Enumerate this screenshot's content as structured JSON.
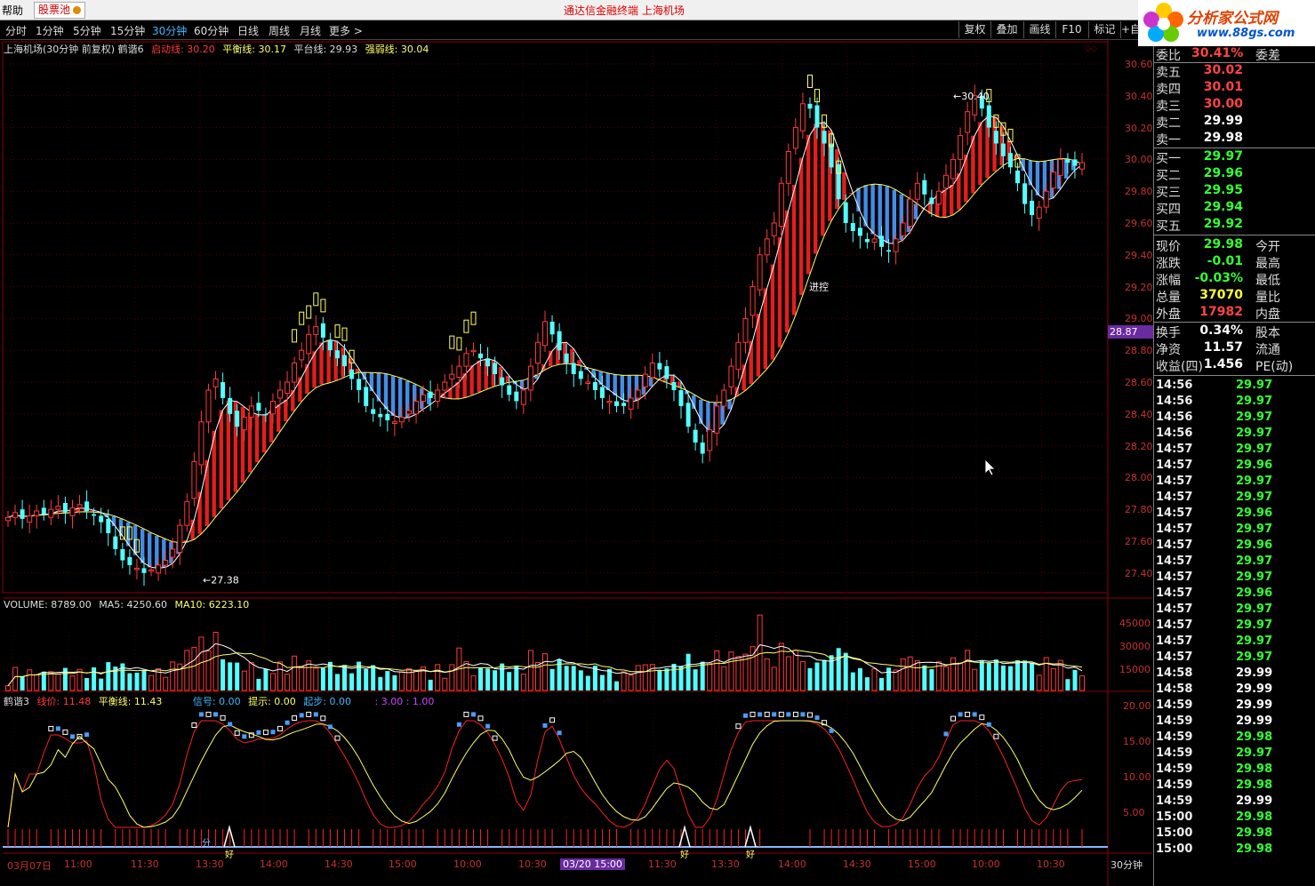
{
  "menu": {
    "help": "帮助",
    "stock_pool": "股票池"
  },
  "app": {
    "title": "通达信金融终端   上海机场"
  },
  "periods": [
    "分时",
    "1分钟",
    "5分钟",
    "15分钟",
    "30分钟",
    "60分钟",
    "日线",
    "周线",
    "月线",
    "更多 >"
  ],
  "active_period": "30分钟",
  "tools": [
    "复权",
    "叠加",
    "画线",
    "F10",
    "标记",
    "+自"
  ],
  "logo": {
    "text": "分析家公式网",
    "url": "www.88gs.com"
  },
  "main_legend": {
    "title": "上海机场(30分钟 前复权) 鹤谐6",
    "start": "启动线: 30.20",
    "balance": "平衡线: 30.17",
    "platform": "平台线: 29.93",
    "strength": "强弱线: 30.04"
  },
  "annotations": {
    "high": "30.40",
    "low": "27.38",
    "probe": "进控"
  },
  "volume_legend": {
    "vol": "VOLUME: 8789.00",
    "ma5": "MA5: 4250.60",
    "ma10": "MA10: 6223.10"
  },
  "osc_legend": {
    "name": "鹤谐3",
    "line": "线价: 11.48",
    "balance": "平衡线: 11.43",
    "signal": "信号: 0.00",
    "hint": "提示: 0.00",
    "start": "起步: 0.00",
    "extra": ": 3.00 : 1.00"
  },
  "marker_labels": {
    "fen": "分",
    "hao": "好"
  },
  "price_axis": [
    "30.60",
    "30.40",
    "30.20",
    "30.00",
    "29.80",
    "29.60",
    "29.40",
    "29.20",
    "29.00",
    "28.80",
    "28.60",
    "28.40",
    "28.20",
    "28.00",
    "27.80",
    "27.60",
    "27.40"
  ],
  "volume_axis": [
    "45000",
    "30000",
    "15000"
  ],
  "osc_axis": [
    "20.00",
    "15.00",
    "10.00",
    "5.00"
  ],
  "price_tag": "28.87",
  "time_axis": [
    "03月07日",
    "11:00",
    "11:30",
    "13:30",
    "14:00",
    "14:30",
    "15:00",
    "10:00",
    "10:30",
    "03/20 15:00",
    "11:30",
    "13:30",
    "14:00",
    "14:30",
    "15:00",
    "10:00",
    "10:30"
  ],
  "bottom_period": "30分钟",
  "colors": {
    "up": "#ff3a3a",
    "down": "#54ffff",
    "grid": "#8b0000",
    "yellow": "#ffff66",
    "white": "#ffffff",
    "green": "#33ff33"
  },
  "quote": {
    "weibi": {
      "label": "委比",
      "value": "30.41%",
      "extra": "委差"
    },
    "asks": [
      {
        "label": "卖五",
        "price": "30.02"
      },
      {
        "label": "卖四",
        "price": "30.01"
      },
      {
        "label": "卖三",
        "price": "30.00"
      },
      {
        "label": "卖二",
        "price": "29.99"
      },
      {
        "label": "卖一",
        "price": "29.98"
      }
    ],
    "bids": [
      {
        "label": "买一",
        "price": "29.97"
      },
      {
        "label": "买二",
        "price": "29.96"
      },
      {
        "label": "买三",
        "price": "29.95"
      },
      {
        "label": "买四",
        "price": "29.94"
      },
      {
        "label": "买五",
        "price": "29.92"
      }
    ],
    "stats1": [
      {
        "label": "现价",
        "value": "29.98",
        "color": "#33ff33",
        "extra": "今开"
      },
      {
        "label": "涨跌",
        "value": "-0.01",
        "color": "#33ff33",
        "extra": "最高"
      },
      {
        "label": "涨幅",
        "value": "-0.03%",
        "color": "#33ff33",
        "extra": "最低"
      },
      {
        "label": "总量",
        "value": "37070",
        "color": "#ffff33",
        "extra": "量比"
      },
      {
        "label": "外盘",
        "value": "17982",
        "color": "#ff4444",
        "extra": "内盘"
      }
    ],
    "stats2": [
      {
        "label": "换手",
        "value": "0.34%",
        "extra": "股本"
      },
      {
        "label": "净资",
        "value": "11.57",
        "extra": "流通"
      },
      {
        "label": "收益(四)",
        "value": "1.456",
        "extra": "PE(动)"
      }
    ]
  },
  "ticks": [
    {
      "t": "14:56",
      "p": "29.97"
    },
    {
      "t": "14:56",
      "p": "29.97"
    },
    {
      "t": "14:56",
      "p": "29.97"
    },
    {
      "t": "14:56",
      "p": "29.97"
    },
    {
      "t": "14:57",
      "p": "29.97"
    },
    {
      "t": "14:57",
      "p": "29.96"
    },
    {
      "t": "14:57",
      "p": "29.97"
    },
    {
      "t": "14:57",
      "p": "29.97"
    },
    {
      "t": "14:57",
      "p": "29.96"
    },
    {
      "t": "14:57",
      "p": "29.97"
    },
    {
      "t": "14:57",
      "p": "29.96"
    },
    {
      "t": "14:57",
      "p": "29.97"
    },
    {
      "t": "14:57",
      "p": "29.97"
    },
    {
      "t": "14:57",
      "p": "29.96"
    },
    {
      "t": "14:57",
      "p": "29.97"
    },
    {
      "t": "14:57",
      "p": "29.97"
    },
    {
      "t": "14:57",
      "p": "29.97"
    },
    {
      "t": "14:57",
      "p": "29.97"
    },
    {
      "t": "14:58",
      "p": "29.99"
    },
    {
      "t": "14:58",
      "p": "29.99"
    },
    {
      "t": "14:59",
      "p": "29.99"
    },
    {
      "t": "14:59",
      "p": "29.99"
    },
    {
      "t": "14:59",
      "p": "29.98"
    },
    {
      "t": "14:59",
      "p": "29.97"
    },
    {
      "t": "14:59",
      "p": "29.98"
    },
    {
      "t": "14:59",
      "p": "29.98"
    },
    {
      "t": "14:59",
      "p": "29.99"
    },
    {
      "t": "15:00",
      "p": "29.98"
    },
    {
      "t": "15:00",
      "p": "29.98"
    },
    {
      "t": "15:00",
      "p": "29.98"
    }
  ]
}
